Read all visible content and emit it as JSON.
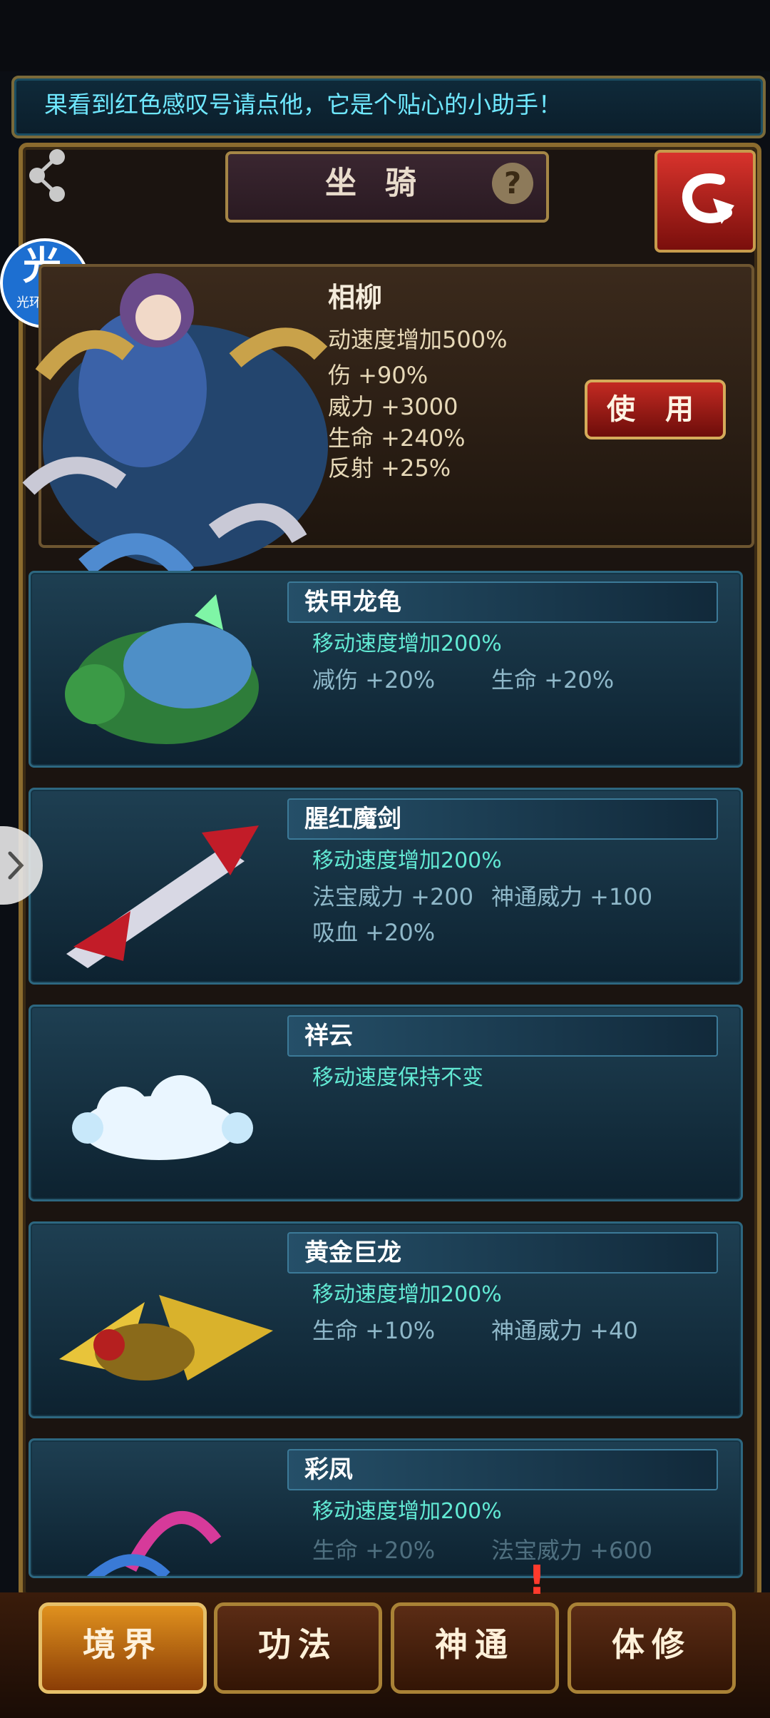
{
  "marquee": {
    "text": "果看到红色感叹号请点他，它是个贴心的小助手！"
  },
  "header": {
    "title": "坐骑",
    "help": "?"
  },
  "helper_badge": {
    "char": "光",
    "label": "光环助手"
  },
  "selected_mount": {
    "name": "相柳",
    "stats": [
      "动速度增加500%",
      "伤 +90%",
      "威力 +3000",
      "生命 +240%",
      "反射 +25%"
    ],
    "use_label": "使 用"
  },
  "mounts": [
    {
      "name": "铁甲龙龟",
      "move": "移动速度增加200%",
      "stats": [
        "减伤 +20%",
        "生命 +20%"
      ]
    },
    {
      "name": "腥红魔剑",
      "move": "移动速度增加200%",
      "stats": [
        "法宝威力 +200",
        "神通威力 +100",
        "吸血 +20%"
      ]
    },
    {
      "name": "祥云",
      "move": "移动速度保持不变",
      "stats": []
    },
    {
      "name": "黄金巨龙",
      "move": "移动速度增加200%",
      "stats": [
        "生命 +10%",
        "神通威力 +40"
      ]
    },
    {
      "name": "彩凤",
      "move": "移动速度增加200%",
      "stats": [
        "生命 +20%",
        "法宝威力 +600"
      ]
    }
  ],
  "tabs": [
    "境界",
    "功法",
    "神通",
    "体修"
  ],
  "alert_mark": "!",
  "colors": {
    "accent_gold": "#a98236",
    "cyan_text": "#62ead4",
    "red_button": "#c32a22"
  },
  "icons": [
    "share-icon",
    "help-icon",
    "back-arrow-icon",
    "chevron-right-icon"
  ]
}
